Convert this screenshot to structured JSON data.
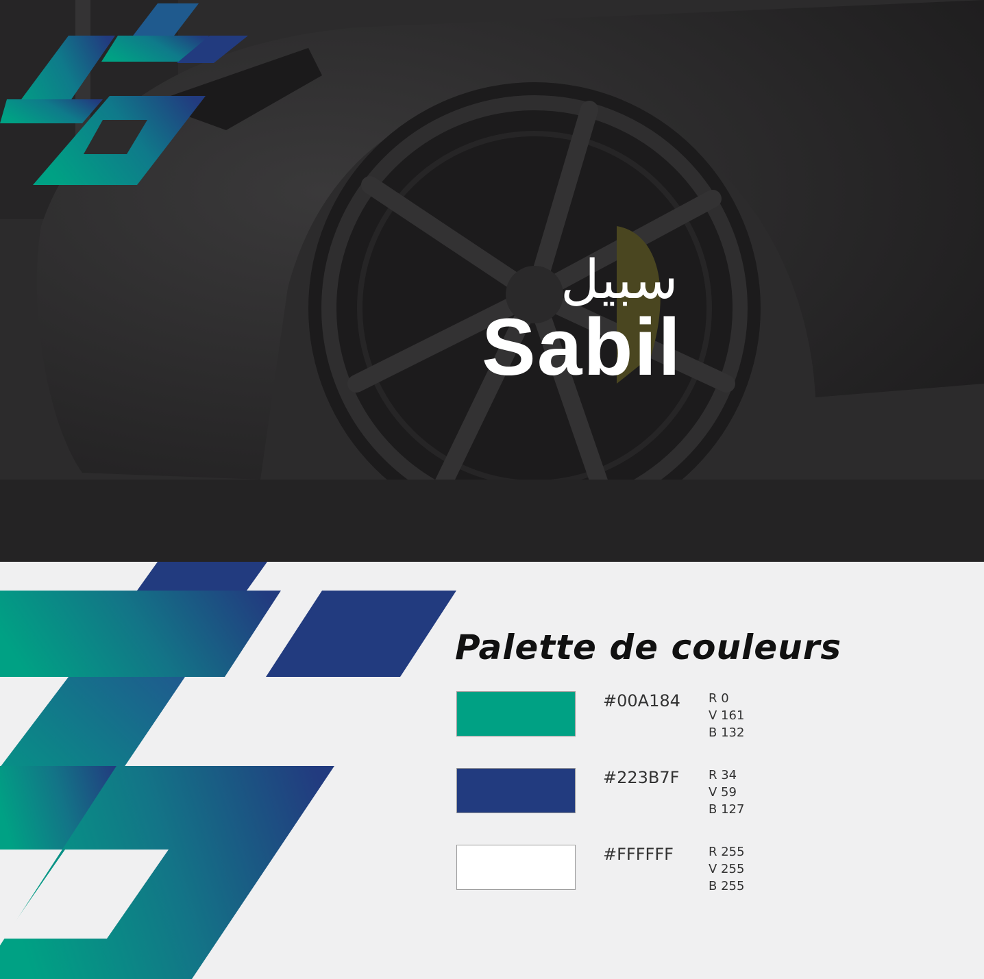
{
  "brand": {
    "arabic_name": "سبيل",
    "latin_name": "Sabil"
  },
  "palette": {
    "title": "Palette de couleurs",
    "colors": [
      {
        "hex_label": "#00A184",
        "r": "R 0",
        "v": "V 161",
        "b": "B 132",
        "color": "#00A184"
      },
      {
        "hex_label": "#223B7F",
        "r": "R 34",
        "v": "V 59",
        "b": "B 127",
        "color": "#223B7F"
      },
      {
        "hex_label": "#FFFFFF",
        "r": "R 255",
        "v": "V 255",
        "b": "B 255",
        "color": "#FFFFFF"
      }
    ]
  }
}
